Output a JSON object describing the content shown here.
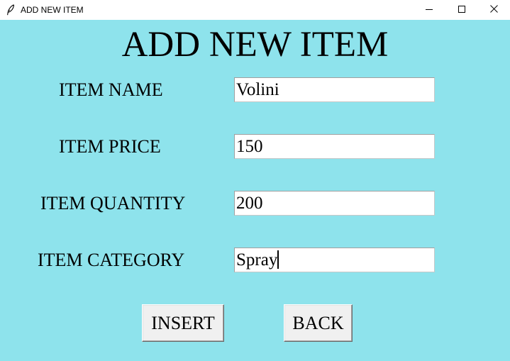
{
  "window": {
    "title": "ADD NEW ITEM",
    "icons": {
      "app": "feather-icon",
      "minimize": "minimize-icon",
      "maximize": "maximize-icon",
      "close": "close-icon"
    }
  },
  "form": {
    "heading": "ADD NEW ITEM",
    "background_color": "#8ee3ec",
    "fields": [
      {
        "label": "ITEM NAME",
        "value": "Volini"
      },
      {
        "label": "ITEM PRICE",
        "value": "150"
      },
      {
        "label": "ITEM QUANTITY",
        "value": "200"
      },
      {
        "label": "ITEM CATEGORY",
        "value": "Spray"
      }
    ],
    "buttons": {
      "insert_label": "INSERT",
      "back_label": "BACK"
    }
  }
}
